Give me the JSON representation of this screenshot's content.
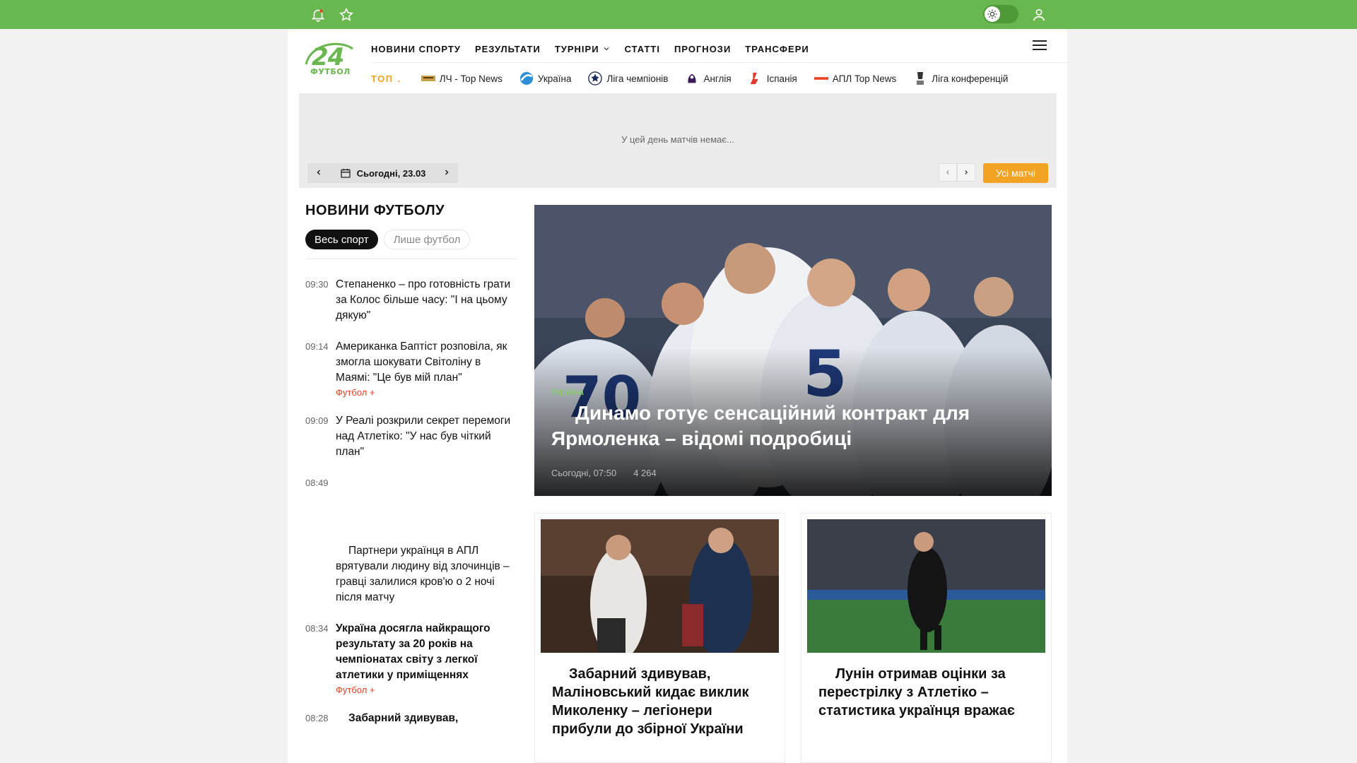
{
  "topbar": {
    "bell_icon": "bell-icon",
    "star_icon": "star-icon",
    "theme_icon": "sun-icon",
    "user_icon": "user-icon",
    "bar_color": "#68b74f"
  },
  "logo": {
    "number": "24",
    "subtitle": "ФУТБОЛ"
  },
  "nav": {
    "items": [
      "НОВИНИ СПОРТУ",
      "РЕЗУЛЬТАТИ",
      "ТУРНІРИ",
      "СТАТТІ",
      "ПРОГНОЗИ",
      "ТРАНСФЕРИ"
    ],
    "menu_icon": "menu-icon"
  },
  "subnav": {
    "top_label": "ТОП",
    "items": [
      {
        "label": "ЛЧ - Top News",
        "icon": "ucl-news-icon"
      },
      {
        "label": "Україна",
        "icon": "upl-icon"
      },
      {
        "label": "Ліга чемпіонів",
        "icon": "ucl-icon"
      },
      {
        "label": "Англія",
        "icon": "epl-icon"
      },
      {
        "label": "Іспанія",
        "icon": "laliga-icon"
      },
      {
        "label": "АПЛ Top News",
        "icon": "epl-news-icon"
      },
      {
        "label": "Ліга конференцій",
        "icon": "uecl-icon"
      }
    ]
  },
  "matches": {
    "empty_text": "У цей день матчів немає...",
    "date_label": "Сьогодні, 23.03",
    "all_button": "Усі матчі",
    "accent": "#f3a324"
  },
  "news": {
    "title": "НОВИНИ ФУТБОЛУ",
    "filters": [
      "Весь спорт",
      "Лише футбол"
    ],
    "items": [
      {
        "time": "09:30",
        "text": "Степаненко – про готовність грати за Колос більше часу: \"І на цьому дякую\"",
        "tag": ""
      },
      {
        "time": "09:14",
        "text": "Американка Баптіст розповіла, як змогла шокувати Світоліну в Маямі: \"Це був мій план\"",
        "tag": "Футбол +"
      },
      {
        "time": "09:09",
        "text": "У Реалі розкрили секрет перемоги над Атлетіко: \"У нас був чіткий план\"",
        "tag": ""
      },
      {
        "time": "08:49",
        "text": "Партнери українця в АПЛ врятували людину від злочинців – гравці залилися кров'ю о 2 ночі після матчу",
        "tag": ""
      },
      {
        "time": "08:34",
        "text": "Україна досягла найкращого результату за 20 років на чемпіонатах світу з легкої атлетики у приміщеннях",
        "tag": "Футбол +"
      },
      {
        "time": "08:28",
        "text": "Забарний здивував,",
        "tag": ""
      }
    ],
    "tag_color": "#e8431f"
  },
  "hero": {
    "category": "Україна",
    "title": "Динамо готує сенсаційний контракт для Ярмоленка – відомі подробиці",
    "date": "Сьогодні, 07:50",
    "views": "4 264"
  },
  "cards": [
    {
      "title": "Забарний здивував, Маліновський кидає виклик Миколенку – легіонери прибули до збірної України"
    },
    {
      "title": "Лунін отримав оцінки за перестрілку з Атлетіко – статистика українця вражає"
    }
  ]
}
